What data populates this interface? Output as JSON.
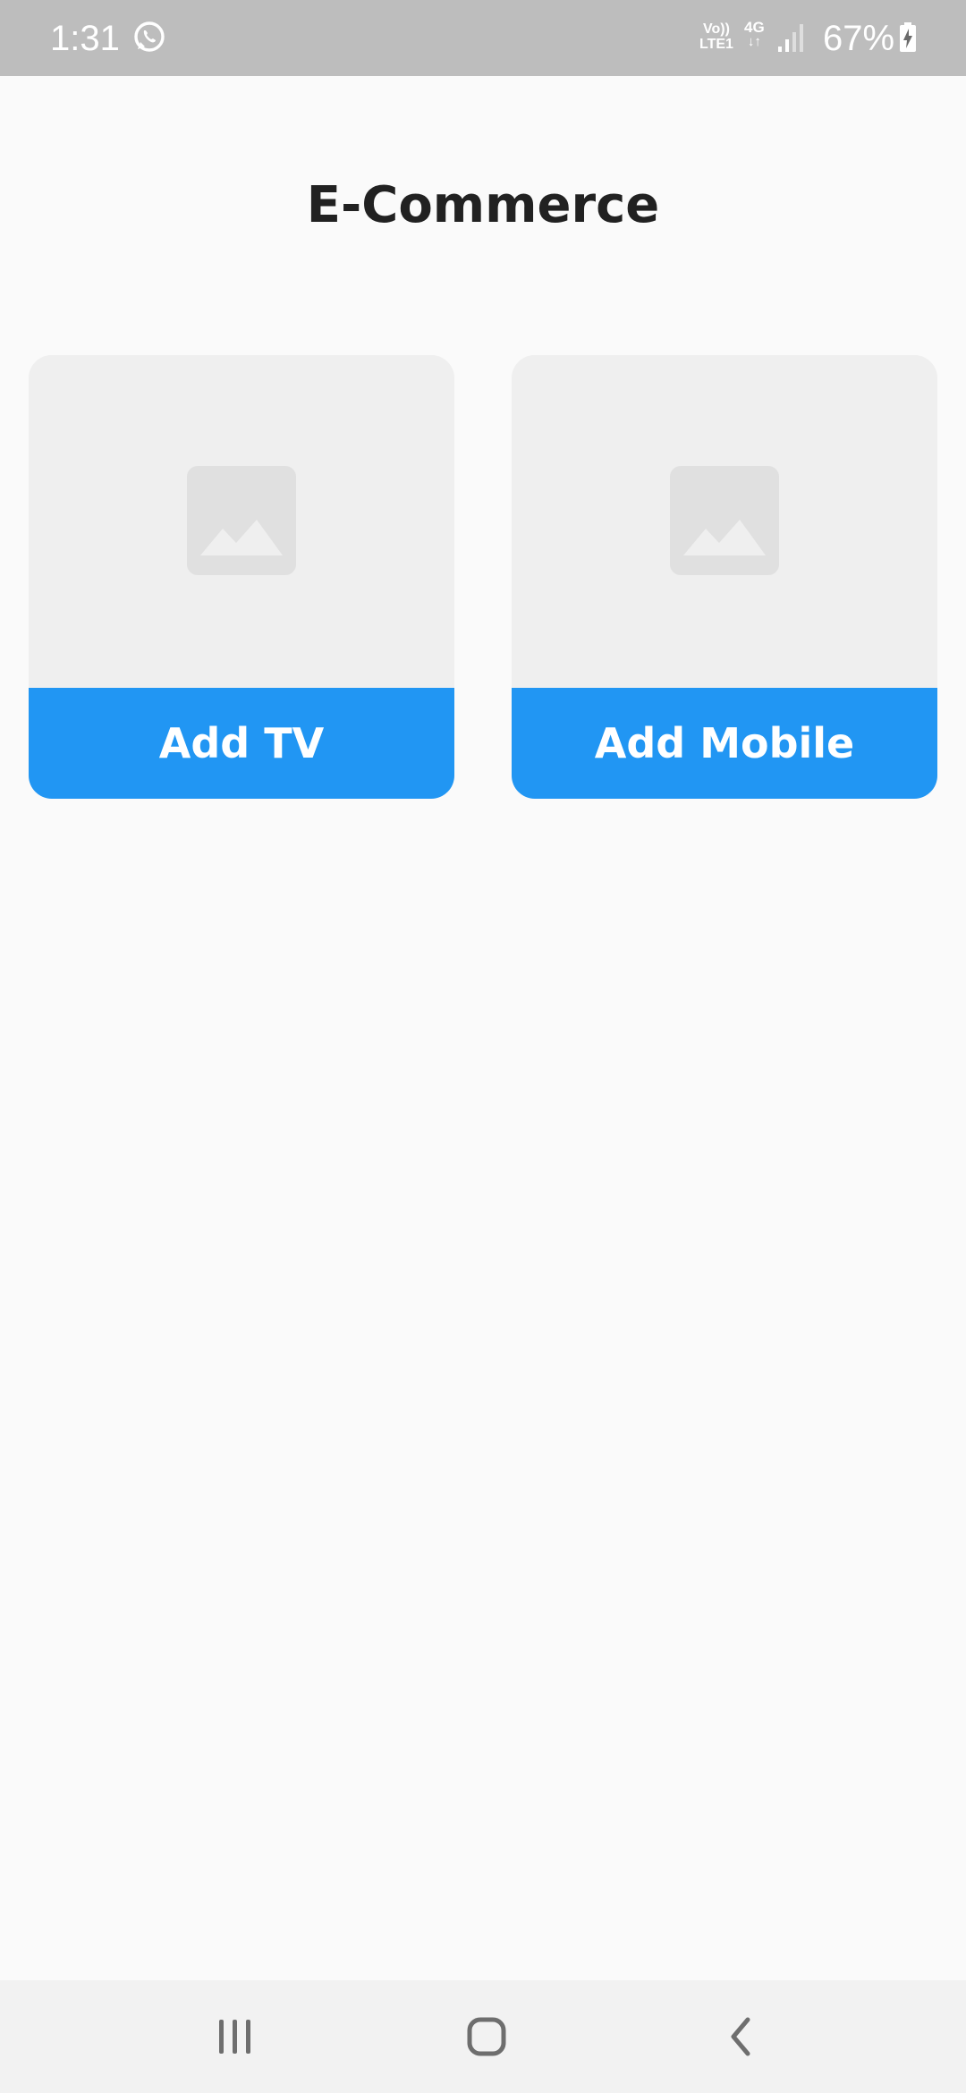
{
  "status_bar": {
    "time": "1:31",
    "volte_line1": "Vo))",
    "volte_line2": "LTE1",
    "network": "4G",
    "network_arrows": "↓↑",
    "battery": "67%",
    "icons": [
      "whatsapp-icon",
      "signal-icon",
      "battery-charging-icon"
    ]
  },
  "header": {
    "title": "E-Commerce"
  },
  "cards": [
    {
      "label": "Add TV",
      "icon": "image-placeholder-icon"
    },
    {
      "label": "Add Mobile",
      "icon": "image-placeholder-icon"
    }
  ],
  "nav_bar": {
    "buttons": [
      "recents-icon",
      "home-icon",
      "back-icon"
    ]
  },
  "colors": {
    "status_bar": "#bdbdbd",
    "background": "#fafafa",
    "card_bg": "#efefef",
    "placeholder": "#e0e0e0",
    "accent": "#2196f3",
    "title": "#212121",
    "nav_bar": "#f2f2f2"
  }
}
